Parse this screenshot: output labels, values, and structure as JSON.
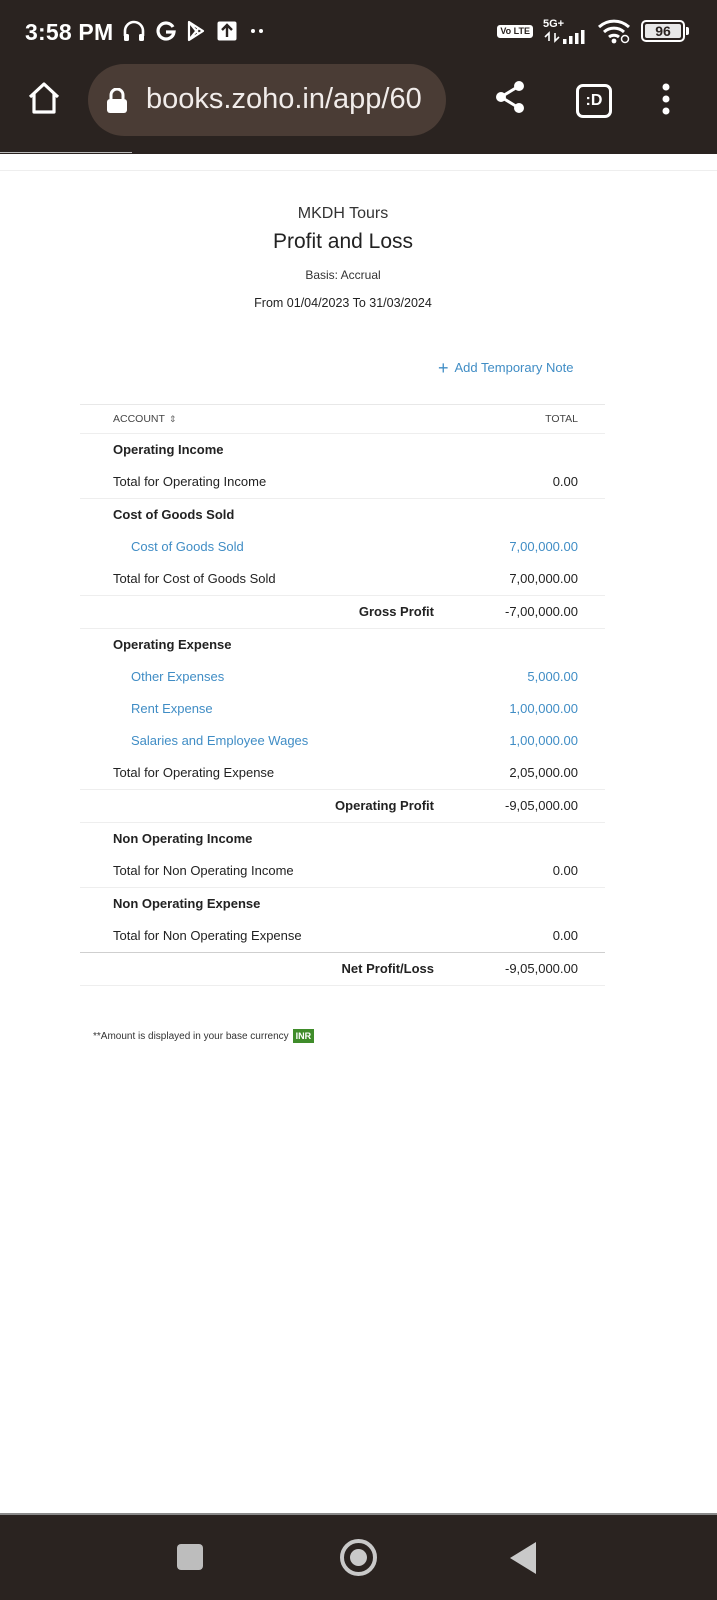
{
  "status_bar": {
    "time": "3:58 PM",
    "network_badge": "Vo LTE",
    "network_type": "5G+",
    "battery": "96"
  },
  "browser": {
    "url": "books.zoho.in/app/60",
    "tab_button": ":D"
  },
  "report": {
    "organization": "MKDH Tours",
    "title": "Profit and Loss",
    "basis": "Basis: Accrual",
    "date_range": "From 01/04/2023 To 31/03/2024",
    "add_note_label": "Add Temporary Note",
    "columns": {
      "account": "ACCOUNT",
      "total": "TOTAL"
    },
    "rows": [
      {
        "type": "section",
        "label": "Operating Income",
        "value": ""
      },
      {
        "type": "total",
        "label": "Total for Operating Income",
        "value": "0.00"
      },
      {
        "type": "section",
        "label": "Cost of Goods Sold",
        "value": ""
      },
      {
        "type": "account",
        "label": "Cost of Goods Sold",
        "value": "7,00,000.00"
      },
      {
        "type": "total",
        "label": "Total for Cost of Goods Sold",
        "value": "7,00,000.00"
      },
      {
        "type": "summary",
        "label": "Gross Profit",
        "value": "-7,00,000.00"
      },
      {
        "type": "section",
        "label": "Operating Expense",
        "value": ""
      },
      {
        "type": "account",
        "label": "Other Expenses",
        "value": "5,000.00"
      },
      {
        "type": "account",
        "label": "Rent Expense",
        "value": "1,00,000.00"
      },
      {
        "type": "account",
        "label": "Salaries and Employee Wages",
        "value": "1,00,000.00"
      },
      {
        "type": "total",
        "label": "Total for Operating Expense",
        "value": "2,05,000.00"
      },
      {
        "type": "summary",
        "label": "Operating Profit",
        "value": "-9,05,000.00"
      },
      {
        "type": "section",
        "label": "Non Operating Income",
        "value": ""
      },
      {
        "type": "total",
        "label": "Total for Non Operating Income",
        "value": "0.00"
      },
      {
        "type": "section",
        "label": "Non Operating Expense",
        "value": ""
      },
      {
        "type": "total",
        "label": "Total for Non Operating Expense",
        "value": "0.00"
      },
      {
        "type": "summary",
        "label": "Net Profit/Loss",
        "value": "-9,05,000.00"
      }
    ],
    "footnote": "**Amount is displayed in your base currency",
    "currency": "INR"
  },
  "colors": {
    "chrome_bg": "#2a2320",
    "url_pill": "#4a3c35",
    "link_blue": "#408dc5",
    "currency_badge": "#3f8c2a"
  },
  "icons": [
    "headphones-icon",
    "google-icon",
    "play-store-icon",
    "upload-icon",
    "more-notifications-icon",
    "signal-icon",
    "wifi-icon",
    "battery-icon",
    "home-icon",
    "lock-icon",
    "share-icon",
    "tab-switcher-icon",
    "kebab-menu-icon",
    "plus-icon",
    "sort-icon",
    "recents-icon",
    "home-circle-icon",
    "back-icon"
  ]
}
